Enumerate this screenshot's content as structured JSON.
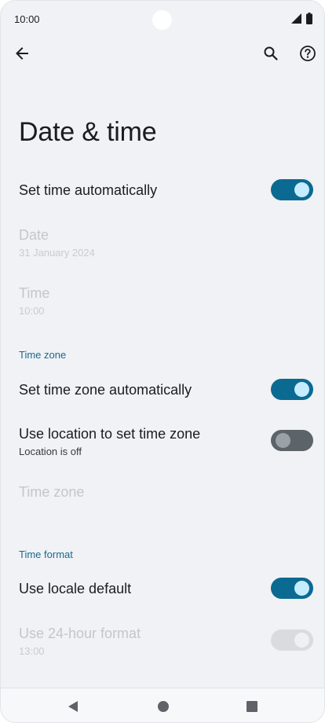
{
  "status_bar": {
    "time": "10:00",
    "icons": [
      "signal-icon",
      "battery-icon"
    ]
  },
  "app_bar": {
    "icons": [
      "back-arrow-icon",
      "search-icon",
      "help-icon"
    ]
  },
  "title": "Date & time",
  "settings": {
    "set_time_automatically": {
      "label": "Set time automatically",
      "on": true
    },
    "date": {
      "label": "Date",
      "value": "31 January 2024",
      "enabled": false
    },
    "time": {
      "label": "Time",
      "value": "10:00",
      "enabled": false
    }
  },
  "time_zone_section": {
    "header": "Time zone",
    "set_time_zone_automatically": {
      "label": "Set time zone automatically",
      "on": true
    },
    "use_location": {
      "label": "Use location to set time zone",
      "summary": "Location is off",
      "on": false
    },
    "time_zone": {
      "label": "Time zone",
      "enabled": false
    }
  },
  "time_format_section": {
    "header": "Time format",
    "use_locale_default": {
      "label": "Use locale default",
      "on": true
    },
    "use_24_hour": {
      "label": "Use 24-hour format",
      "value": "13:00",
      "on": true,
      "enabled": false
    }
  },
  "nav_bar": {
    "icons": [
      "nav-back-icon",
      "nav-home-icon",
      "nav-recents-icon"
    ]
  },
  "colors": {
    "accent": "#0b6a92",
    "section_header": "#1a6a8c",
    "background": "#f0f2f5"
  }
}
